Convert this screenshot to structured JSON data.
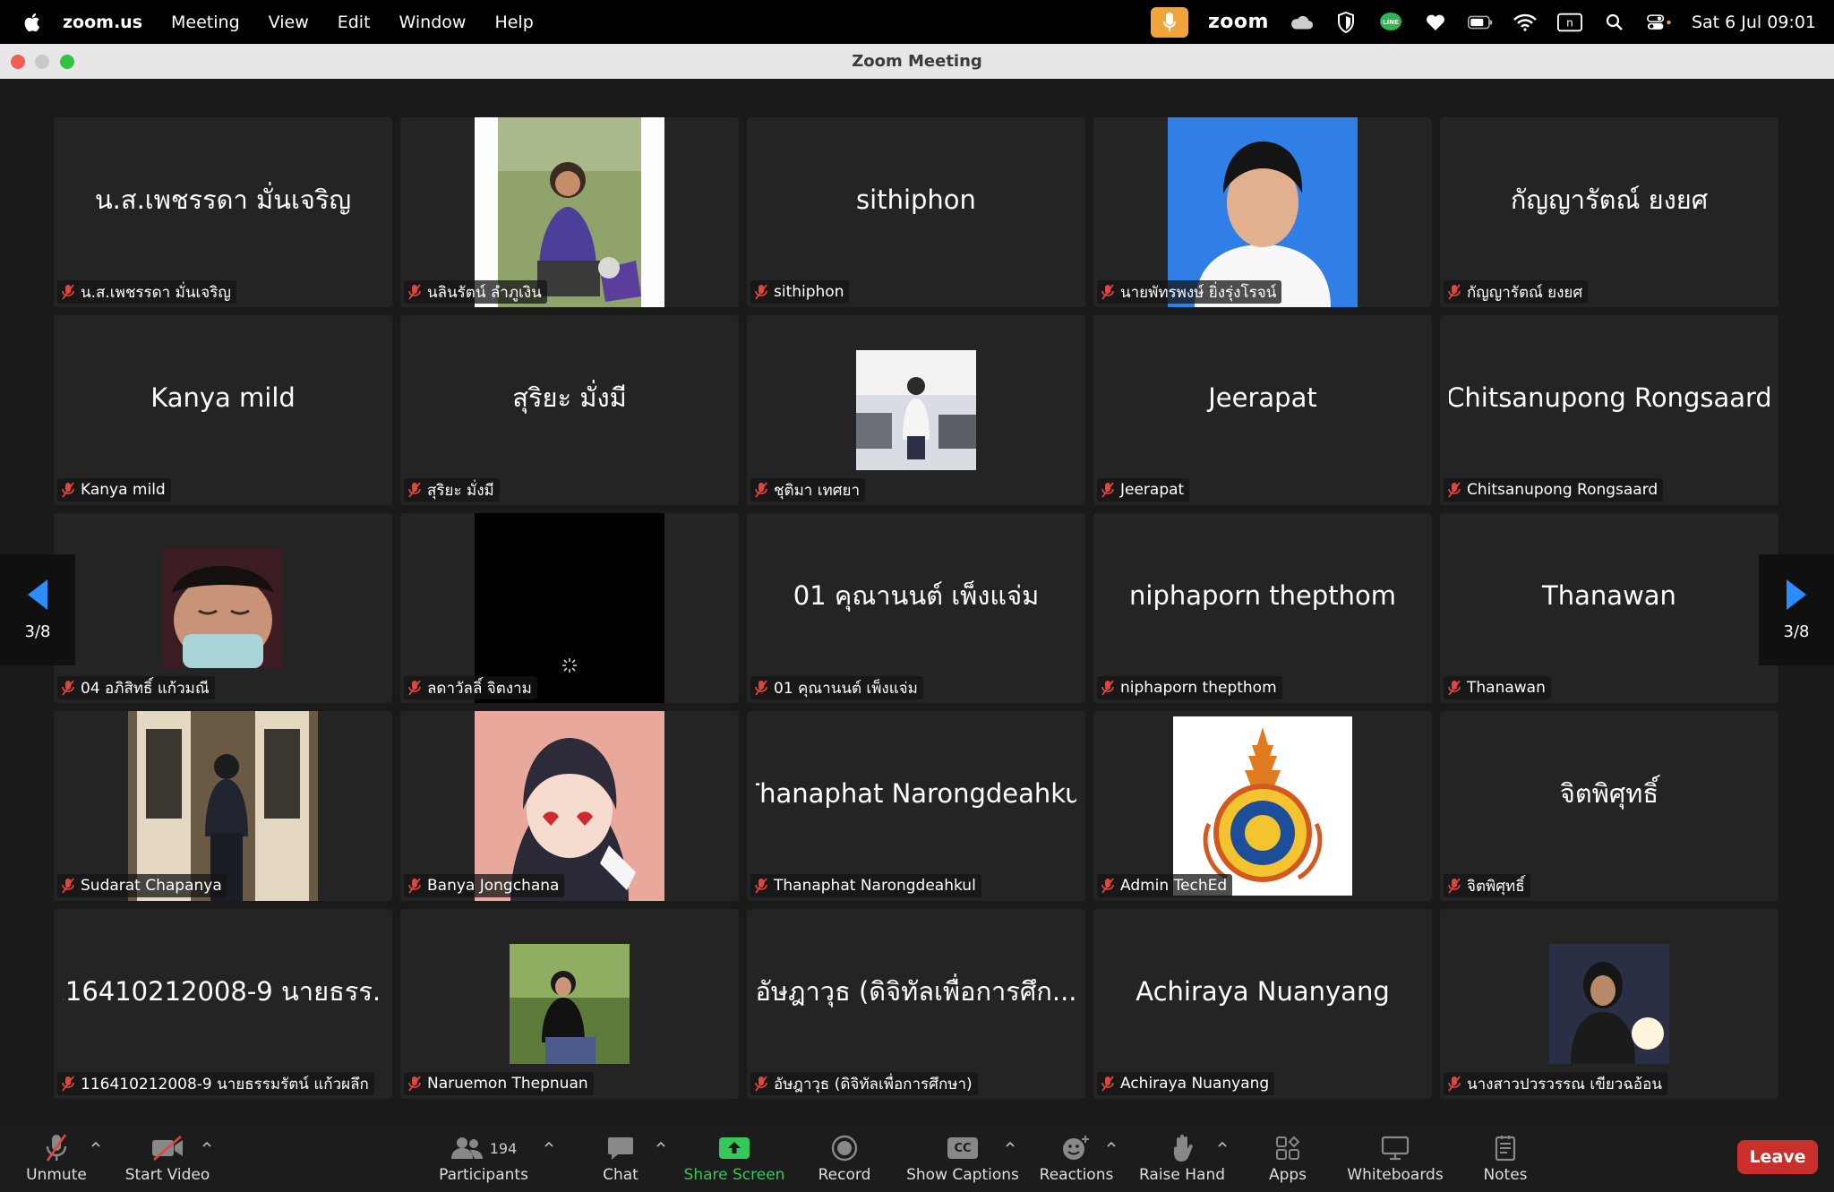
{
  "menubar": {
    "app": "zoom.us",
    "items": [
      "Meeting",
      "View",
      "Edit",
      "Window",
      "Help"
    ],
    "zoom_word": "zoom",
    "clock": "Sat 6 Jul  09:01",
    "icons": [
      "apple-icon",
      "microphone-icon",
      "cloud-icon",
      "shield-icon",
      "line-icon",
      "heart-icon",
      "battery-icon",
      "wifi-icon",
      "input-source-icon",
      "search-icon",
      "control-center-icon"
    ]
  },
  "window": {
    "title": "Zoom Meeting"
  },
  "pager": {
    "label": "3/8"
  },
  "participants": [
    {
      "name": "น.ส.เพชรรดา มั่นเจริญ",
      "display": "น.ส.เพชรรดา มั่นเจริญ",
      "type": "name"
    },
    {
      "name": "นลินรัตน์ ลำภูเงิน",
      "display": "",
      "type": "video"
    },
    {
      "name": "sithiphon",
      "display": "sithiphon",
      "type": "name"
    },
    {
      "name": "นายพัทรพงษ์ ยิ่งรุ่งโรจน์",
      "display": "",
      "type": "video"
    },
    {
      "name": "กัญญารัตณ์ ยงยศ",
      "display": "กัญญารัตณ์ ยงยศ",
      "type": "name"
    },
    {
      "name": "Kanya mild",
      "display": "Kanya mild",
      "type": "name"
    },
    {
      "name": "สุริยะ มั่งมี",
      "display": "สุริยะ มั่งมี",
      "type": "name"
    },
    {
      "name": "ชุติมา เทศยา",
      "display": "",
      "type": "photo"
    },
    {
      "name": "Jeerapat",
      "display": "Jeerapat",
      "type": "name"
    },
    {
      "name": "Chitsanupong Rongsaard",
      "display": "Chitsanupong Rongsaard",
      "type": "name"
    },
    {
      "name": "04 อภิสิทธิ์ แก้วมณี",
      "display": "",
      "type": "photo"
    },
    {
      "name": "ลดาวัลลิ์ จิตงาม",
      "display": "",
      "type": "video"
    },
    {
      "name": "01 คุณานนต์ เพ็งแจ่ม",
      "display": "01 คุณานนต์ เพ็งแจ่ม",
      "type": "name"
    },
    {
      "name": "niphaporn thepthom",
      "display": "niphaporn thepthom",
      "type": "name"
    },
    {
      "name": "Thanawan",
      "display": "Thanawan",
      "type": "name"
    },
    {
      "name": "Sudarat Chapanya",
      "display": "",
      "type": "video"
    },
    {
      "name": "Banya Jongchana",
      "display": "",
      "type": "video"
    },
    {
      "name": "Thanaphat Narongdeahkul",
      "display": "Thanaphat Narongdeahkul",
      "type": "name"
    },
    {
      "name": "Admin TechEd",
      "display": "",
      "type": "logo"
    },
    {
      "name": "จิตพิศุทธิ์",
      "display": "จิตพิศุทธิ์",
      "type": "name"
    },
    {
      "name": "116410212008-9 นายธรรมรัตน์ แก้วผลึก",
      "display": "116410212008-9 นายธรร...",
      "type": "name"
    },
    {
      "name": "Naruemon Thepnuan",
      "display": "",
      "type": "photo"
    },
    {
      "name": "อัษฎาวุธ (ดิจิทัลเพื่อการศึกษา)",
      "display": "อัษฎาวุธ (ดิจิทัลเพื่อการศึก...",
      "type": "name"
    },
    {
      "name": "Achiraya Nuanyang",
      "display": "Achiraya Nuanyang",
      "type": "name"
    },
    {
      "name": "นางสาวปวรวรรณ เขียวฉอ้อน",
      "display": "",
      "type": "photo"
    }
  ],
  "toolbar": {
    "unmute": "Unmute",
    "start_video": "Start Video",
    "participants": "Participants",
    "participant_count": "194",
    "chat": "Chat",
    "share_screen": "Share Screen",
    "record": "Record",
    "show_captions": "Show Captions",
    "cc_badge": "CC",
    "reactions": "Reactions",
    "raise_hand": "Raise Hand",
    "apps": "Apps",
    "whiteboards": "Whiteboards",
    "notes": "Notes",
    "leave": "Leave"
  },
  "colors": {
    "share_green": "#35c759",
    "leave_red": "#c9302c",
    "mute_red": "#e0463e",
    "pager_blue": "#2d8cff"
  }
}
